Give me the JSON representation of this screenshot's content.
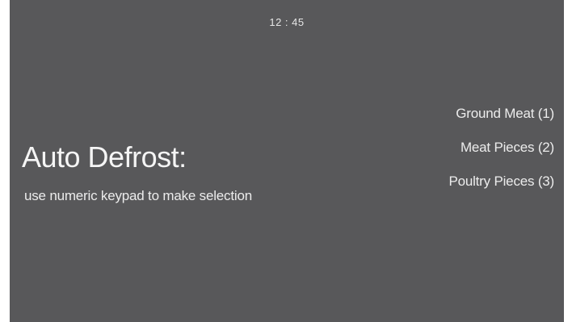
{
  "screen": {
    "clock": "12 : 45",
    "title": "Auto Defrost:",
    "instruction": "use numeric keypad to make selection",
    "options": [
      {
        "label": "Ground Meat (1)"
      },
      {
        "label": "Meat Pieces (2)"
      },
      {
        "label": "Poultry Pieces (3)"
      }
    ],
    "colors": {
      "background": "#58585a",
      "text": "#f2f2f2"
    }
  }
}
